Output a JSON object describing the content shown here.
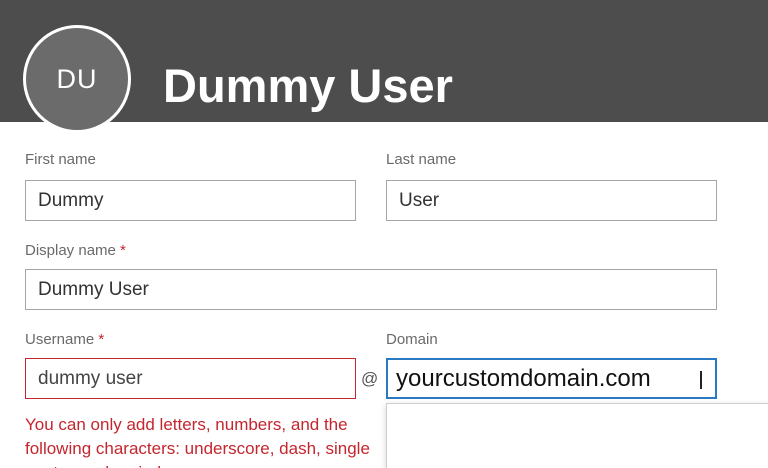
{
  "header": {
    "avatar_initials": "DU",
    "user_name": "Dummy User"
  },
  "form": {
    "first_name": {
      "label": "First name",
      "value": "Dummy"
    },
    "last_name": {
      "label": "Last name",
      "value": "User"
    },
    "display_name": {
      "label": "Display name",
      "required_marker": "*",
      "value": "Dummy User"
    },
    "username": {
      "label": "Username",
      "required_marker": "*",
      "value": "dummy user"
    },
    "at_sign": "@",
    "domain": {
      "label": "Domain",
      "value": "yourcustomdomain.com"
    },
    "username_error": "You can only add letters, numbers, and the following characters: underscore, dash, single quotes and periods."
  },
  "colors": {
    "header_bg": "#4d4d4d",
    "error": "#c4262e",
    "focus": "#2b79c2"
  }
}
